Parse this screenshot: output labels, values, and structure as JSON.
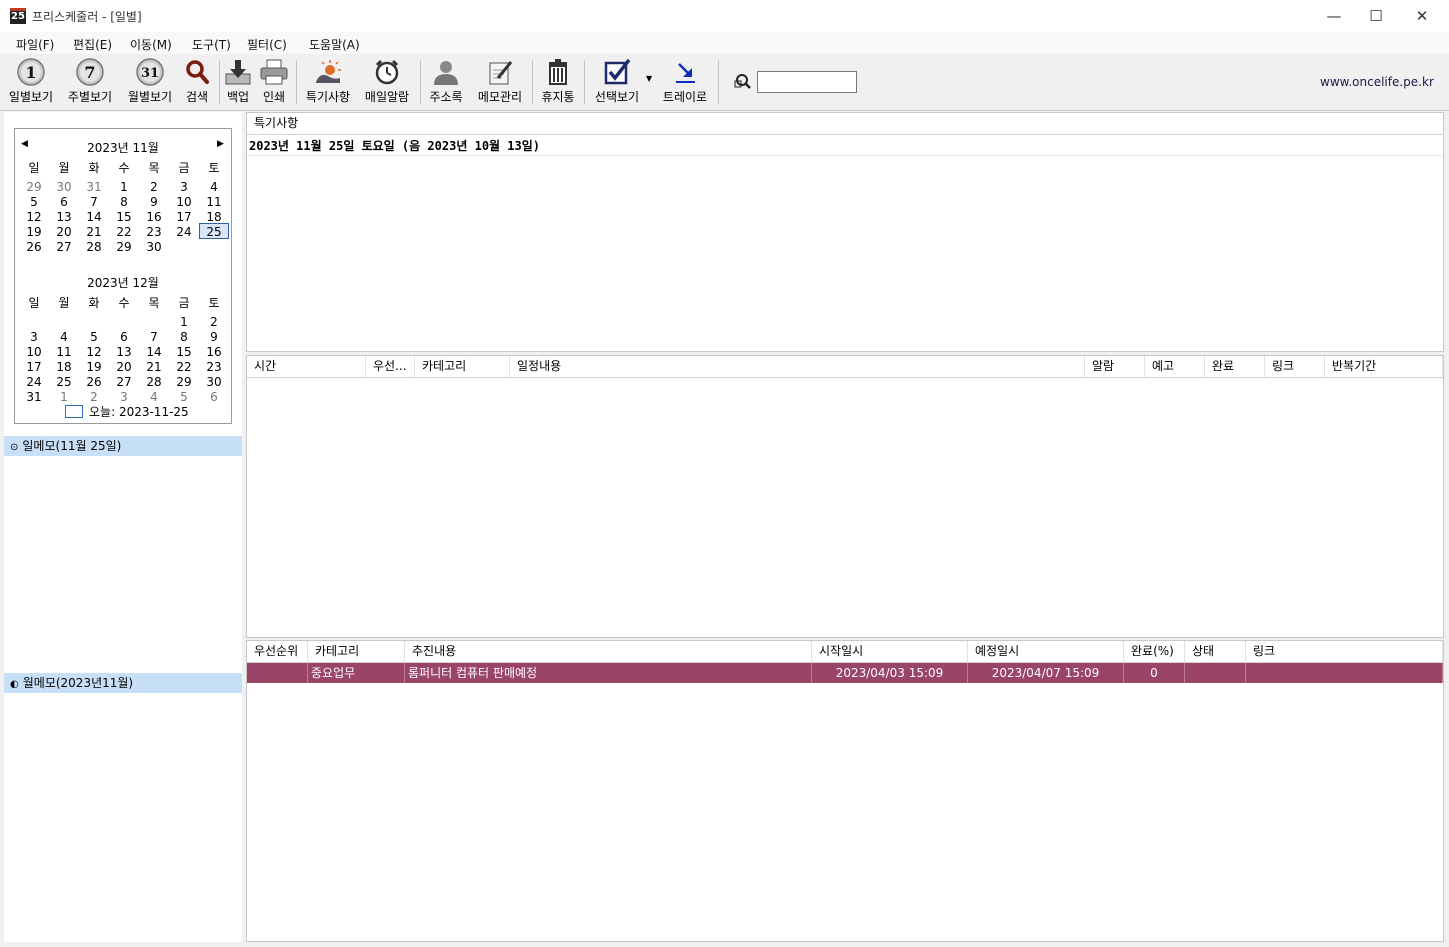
{
  "window": {
    "title": "프리스케줄러 - [일별]",
    "app_icon_text": "25",
    "minimize": "—",
    "maximize": "☐",
    "close": "✕"
  },
  "menu": [
    "파일(F)",
    "편집(E)",
    "이동(M)",
    "도구(T)",
    "필터(C)",
    "도움말(A)"
  ],
  "toolbar": {
    "daily": "일별보기",
    "weekly": "주별보기",
    "monthly": "월별보기",
    "search": "검색",
    "backup": "백업",
    "print": "인쇄",
    "special": "특기사항",
    "alarm": "매일알람",
    "address": "주소록",
    "memo": "메모관리",
    "trash": "휴지통",
    "select_view": "선택보기",
    "tray": "트레이로",
    "daily_icon": "1",
    "weekly_icon": "7",
    "monthly_icon": "31",
    "search_value": "",
    "website": "www.oncelife.pe.kr"
  },
  "calendar": {
    "weekdays": [
      "일",
      "월",
      "화",
      "수",
      "목",
      "금",
      "토"
    ],
    "nov": {
      "title": "2023년 11월",
      "rows": [
        [
          "29",
          "30",
          "31",
          "1",
          "2",
          "3",
          "4"
        ],
        [
          "5",
          "6",
          "7",
          "8",
          "9",
          "10",
          "11"
        ],
        [
          "12",
          "13",
          "14",
          "15",
          "16",
          "17",
          "18"
        ],
        [
          "19",
          "20",
          "21",
          "22",
          "23",
          "24",
          "25"
        ],
        [
          "26",
          "27",
          "28",
          "29",
          "30",
          "",
          ""
        ]
      ]
    },
    "dec": {
      "title": "2023년 12월",
      "rows": [
        [
          "",
          "",
          "",
          "",
          "",
          "1",
          "2"
        ],
        [
          "3",
          "4",
          "5",
          "6",
          "7",
          "8",
          "9"
        ],
        [
          "10",
          "11",
          "12",
          "13",
          "14",
          "15",
          "16"
        ],
        [
          "17",
          "18",
          "19",
          "20",
          "21",
          "22",
          "23"
        ],
        [
          "24",
          "25",
          "26",
          "27",
          "28",
          "29",
          "30"
        ],
        [
          "31",
          "1",
          "2",
          "3",
          "4",
          "5",
          "6"
        ]
      ]
    },
    "today": "오늘: 2023-11-25"
  },
  "memos": {
    "day_memo": "일메모(11월 25일)",
    "month_memo": "월메모(2023년11월)"
  },
  "special": {
    "header": "특기사항",
    "date_line": "2023년 11월 25일 토요일  (음 2023년 10월 13일)"
  },
  "schedule": {
    "columns": [
      "시간",
      "우선...",
      "카테고리",
      "일정내용",
      "알람",
      "예고",
      "완료",
      "링크",
      "반복기간"
    ]
  },
  "tasks": {
    "columns": [
      "우선순위",
      "카테고리",
      "추진내용",
      "시작일시",
      "예정일시",
      "완료(%)",
      "상태",
      "링크"
    ],
    "rows": [
      {
        "priority": "",
        "category": "중요업무",
        "content": "롬퍼니터 컴퓨터 판매예정",
        "start": "2023/04/03 15:09",
        "due": "2023/04/07 15:09",
        "done": "0",
        "status": "",
        "link": ""
      }
    ]
  },
  "colors": {
    "task_row_bg": "#9a4468",
    "memo_header_bg": "#c7e0f8",
    "calendar_selected": "#2f5f9f"
  }
}
